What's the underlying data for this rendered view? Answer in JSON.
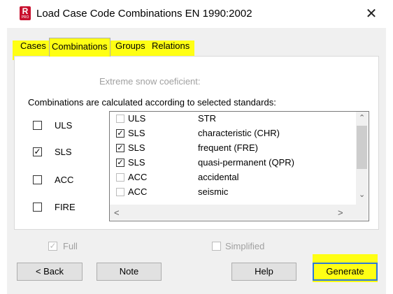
{
  "window": {
    "title": "Load Case Code Combinations EN 1990:2002",
    "app_icon_letter": "R",
    "app_icon_sub": "PRO",
    "close_glyph": "✕"
  },
  "tabs": [
    {
      "label": "Cases",
      "active": false
    },
    {
      "label": "Combinations",
      "active": true
    },
    {
      "label": "Groups",
      "active": false
    },
    {
      "label": "Relations",
      "active": false
    }
  ],
  "panel": {
    "snow_label": "Extreme snow coeficient:",
    "standards_caption": "Combinations are calculated according to selected standards:",
    "standards": [
      {
        "label": "ULS",
        "checked": false
      },
      {
        "label": "SLS",
        "checked": true
      },
      {
        "label": "ACC",
        "checked": false
      },
      {
        "label": "FIRE",
        "checked": false
      }
    ],
    "combination_list": [
      {
        "type": "ULS",
        "name": "STR",
        "checked": false
      },
      {
        "type": "SLS",
        "name": "characteristic (CHR)",
        "checked": true
      },
      {
        "type": "SLS",
        "name": "frequent (FRE)",
        "checked": true
      },
      {
        "type": "SLS",
        "name": "quasi-permanent (QPR)",
        "checked": true
      },
      {
        "type": "ACC",
        "name": "accidental",
        "checked": false
      },
      {
        "type": "ACC",
        "name": "seismic",
        "checked": false
      }
    ]
  },
  "options": {
    "full_label": "Full",
    "full_checked": true,
    "simplified_label": "Simplified",
    "simplified_checked": false
  },
  "buttons": {
    "back": "< Back",
    "note": "Note",
    "help": "Help",
    "generate": "Generate"
  },
  "icons": {
    "check": "✓",
    "scroll_up": "⌃",
    "scroll_down": "⌄",
    "scroll_left": "<",
    "scroll_right": ">"
  }
}
